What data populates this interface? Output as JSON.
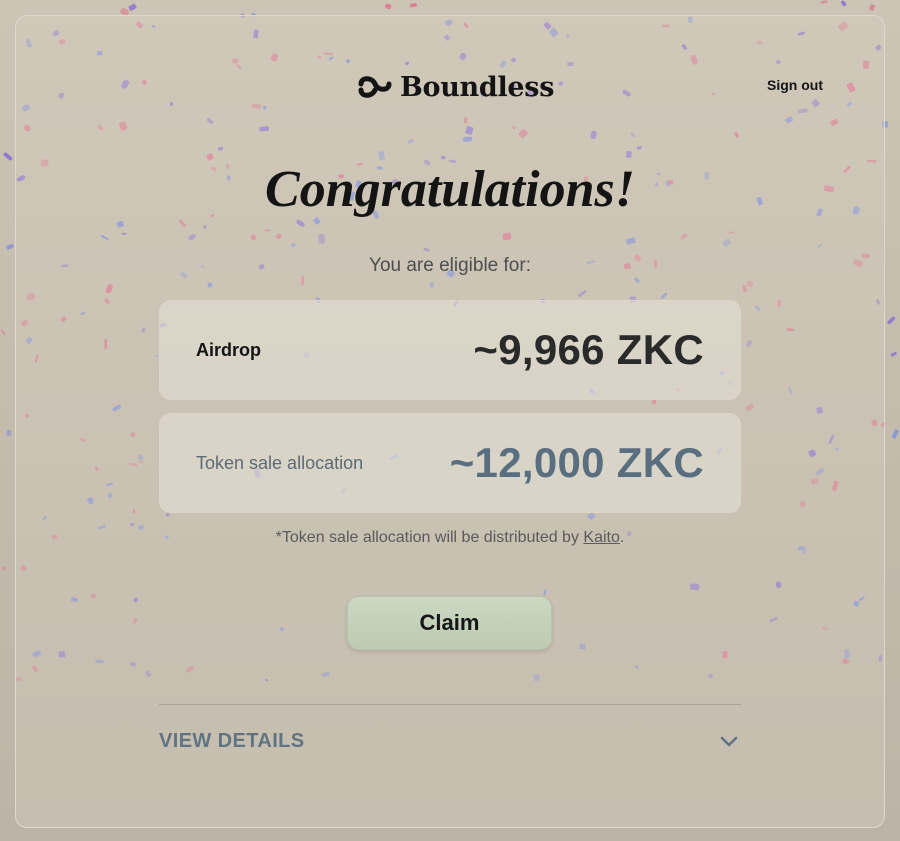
{
  "header": {
    "brand": "Boundless",
    "sign_out_label": "Sign out"
  },
  "main": {
    "heading": "Congratulations!",
    "subheading": "You are eligible for:",
    "allocations": [
      {
        "label": "Airdrop",
        "amount": "~9,966 ZKC"
      },
      {
        "label": "Token sale allocation",
        "amount": "~12,000 ZKC"
      }
    ],
    "note": {
      "prefix": "*Token sale allocation will be distributed by ",
      "link": "Kaito",
      "suffix": "."
    },
    "claim_label": "Claim",
    "details_label": "VIEW DETAILS"
  },
  "icons": {
    "logo": "boundless-logo-icon",
    "details_toggle": "chevron-down-icon"
  },
  "colors": {
    "confetti_pink": "#e0708e",
    "confetti_purple": "#8b6ed6",
    "confetti_blue": "#7d8be0",
    "claim_green": "#c4d2ba",
    "accent_slate": "#617482"
  }
}
